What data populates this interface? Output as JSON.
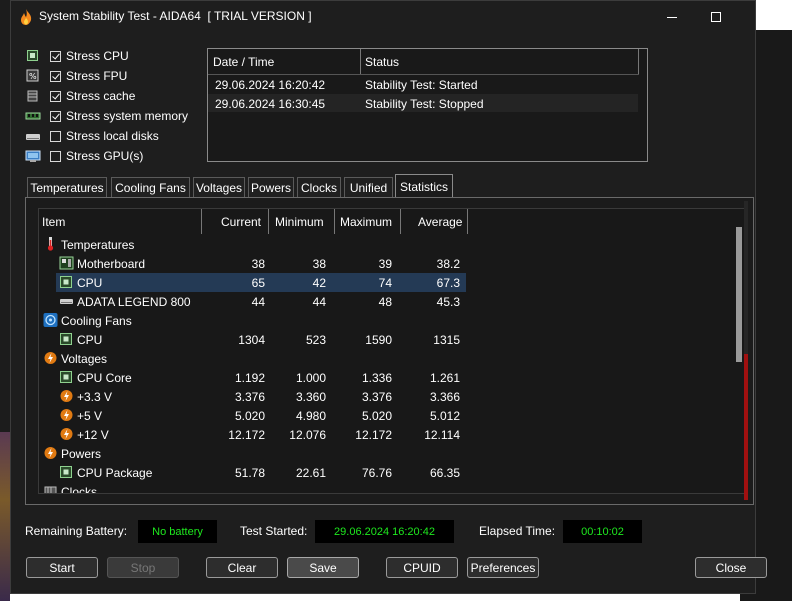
{
  "window": {
    "title": "System Stability Test - AIDA64  [ TRIAL VERSION ]"
  },
  "options": [
    {
      "label": "Stress CPU",
      "checked": true,
      "icon": "cpu-chip-icon"
    },
    {
      "label": "Stress FPU",
      "checked": true,
      "icon": "fpu-chip-icon"
    },
    {
      "label": "Stress cache",
      "checked": true,
      "icon": "cache-icon"
    },
    {
      "label": "Stress system memory",
      "checked": true,
      "icon": "memory-icon"
    },
    {
      "label": "Stress local disks",
      "checked": false,
      "icon": "disk-icon"
    },
    {
      "label": "Stress GPU(s)",
      "checked": false,
      "icon": "gpu-icon"
    }
  ],
  "log": {
    "headers": [
      "Date / Time",
      "Status"
    ],
    "rows": [
      {
        "time": "29.06.2024 16:20:42",
        "status": "Stability Test: Started"
      },
      {
        "time": "29.06.2024 16:30:45",
        "status": "Stability Test: Stopped"
      }
    ]
  },
  "tabs": [
    "Temperatures",
    "Cooling Fans",
    "Voltages",
    "Powers",
    "Clocks",
    "Unified",
    "Statistics"
  ],
  "active_tab": "Statistics",
  "stats": {
    "headers": [
      "Item",
      "Current",
      "Minimum",
      "Maximum",
      "Average"
    ],
    "rows": [
      {
        "type": "group",
        "label": "Temperatures",
        "icon": "thermometer-icon"
      },
      {
        "type": "item",
        "label": "Motherboard",
        "icon": "motherboard-icon",
        "cur": "38",
        "min": "38",
        "max": "39",
        "avg": "38.2"
      },
      {
        "type": "item",
        "label": "CPU",
        "icon": "cpu-chip-icon",
        "cur": "65",
        "min": "42",
        "max": "74",
        "avg": "67.3",
        "selected": true
      },
      {
        "type": "item",
        "label": "ADATA LEGEND 800",
        "icon": "disk-icon",
        "cur": "44",
        "min": "44",
        "max": "48",
        "avg": "45.3"
      },
      {
        "type": "group",
        "label": "Cooling Fans",
        "icon": "fan-icon"
      },
      {
        "type": "item",
        "label": "CPU",
        "icon": "cpu-chip-icon",
        "cur": "1304",
        "min": "523",
        "max": "1590",
        "avg": "1315"
      },
      {
        "type": "group",
        "label": "Voltages",
        "icon": "voltage-icon"
      },
      {
        "type": "item",
        "label": "CPU Core",
        "icon": "cpu-chip-icon",
        "cur": "1.192",
        "min": "1.000",
        "max": "1.336",
        "avg": "1.261"
      },
      {
        "type": "item",
        "label": "+3.3 V",
        "icon": "voltage-icon",
        "cur": "3.376",
        "min": "3.360",
        "max": "3.376",
        "avg": "3.366"
      },
      {
        "type": "item",
        "label": "+5 V",
        "icon": "voltage-icon",
        "cur": "5.020",
        "min": "4.980",
        "max": "5.020",
        "avg": "5.012"
      },
      {
        "type": "item",
        "label": "+12 V",
        "icon": "voltage-icon",
        "cur": "12.172",
        "min": "12.076",
        "max": "12.172",
        "avg": "12.114"
      },
      {
        "type": "group",
        "label": "Powers",
        "icon": "power-icon"
      },
      {
        "type": "item",
        "label": "CPU Package",
        "icon": "cpu-chip-icon",
        "cur": "51.78",
        "min": "22.61",
        "max": "76.76",
        "avg": "66.35"
      },
      {
        "type": "group",
        "label": "Clocks",
        "icon": "clock-icon"
      }
    ]
  },
  "info": {
    "battery_label": "Remaining Battery:",
    "battery_value": "No battery",
    "started_label": "Test Started:",
    "started_value": "29.06.2024 16:20:42",
    "elapsed_label": "Elapsed Time:",
    "elapsed_value": "00:10:02"
  },
  "buttons": {
    "start": "Start",
    "stop": "Stop",
    "clear": "Clear",
    "save": "Save",
    "cpuid": "CPUID",
    "preferences": "Preferences",
    "close": "Close"
  },
  "colors": {
    "info_text": "#1ee81e",
    "selection": "#243a55",
    "accent_red": "#a01010"
  }
}
